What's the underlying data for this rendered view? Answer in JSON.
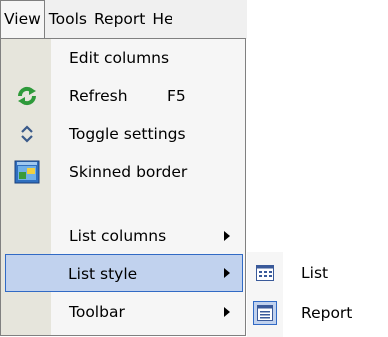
{
  "menubar": {
    "items": [
      {
        "label": "View",
        "active": true
      },
      {
        "label": "Tools",
        "active": false
      },
      {
        "label": "Report",
        "active": false
      },
      {
        "label": "He",
        "active": false
      }
    ]
  },
  "view_menu": {
    "items": [
      {
        "label": "Edit columns",
        "icon": null
      },
      {
        "label": "Refresh",
        "shortcut": "F5",
        "icon": "refresh-icon"
      },
      {
        "label": "Toggle settings",
        "icon": "toggle-arrows-icon"
      },
      {
        "label": "Skinned border",
        "icon": "window-skin-icon"
      },
      {
        "label": "List columns",
        "submenu": true
      },
      {
        "label": "List style",
        "submenu": true,
        "highlighted": true
      },
      {
        "label": "Toolbar",
        "submenu": true
      }
    ]
  },
  "list_style_submenu": {
    "items": [
      {
        "label": "List",
        "icon": "list-view-icon",
        "checked": false
      },
      {
        "label": "Report",
        "icon": "report-view-icon",
        "checked": true
      }
    ]
  },
  "colors": {
    "highlight_fill": "#c1d2ee",
    "highlight_border": "#316ac5",
    "menu_bg": "#f6f6f6",
    "gutter": "#e6e5dc"
  }
}
